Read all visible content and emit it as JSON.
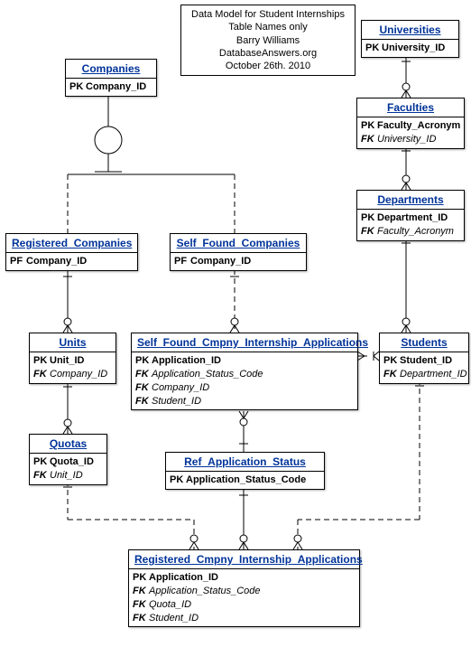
{
  "info": {
    "line1": "Data Model for Student Internships",
    "line2": "Table Names only",
    "line3": "Barry Williams",
    "line4": "DatabaseAnswers.org",
    "line5": "October 26th. 2010"
  },
  "entities": {
    "companies": {
      "title": "Companies",
      "pk": "Company_ID"
    },
    "universities": {
      "title": "Universities",
      "pk": "University_ID"
    },
    "faculties": {
      "title": "Faculties",
      "pk": "Faculty_Acronym",
      "fk1": "University_ID"
    },
    "departments": {
      "title": "Departments",
      "pk": "Department_ID",
      "fk1": "Faculty_Acronym"
    },
    "registered_companies": {
      "title": "Registered_Companies",
      "pf": "Company_ID"
    },
    "self_found_companies": {
      "title": "Self_Found_Companies",
      "pf": "Company_ID"
    },
    "students": {
      "title": "Students",
      "pk": "Student_ID",
      "fk1": "Department_ID"
    },
    "units": {
      "title": "Units",
      "pk": "Unit_ID",
      "fk1": "Company_ID"
    },
    "self_found_app": {
      "title": "Self_Found_Cmpny_Internship_Applications",
      "pk": "Application_ID",
      "fk1": "Application_Status_Code",
      "fk2": "Company_ID",
      "fk3": "Student_ID"
    },
    "quotas": {
      "title": "Quotas",
      "pk": "Quota_ID",
      "fk1": "Unit_ID"
    },
    "ref_app_status": {
      "title": "Ref_Application_Status",
      "pk": "Application_Status_Code"
    },
    "registered_app": {
      "title": "Registered_Cmpny_Internship_Applications",
      "pk": "Application_ID",
      "fk1": "Application_Status_Code",
      "fk2": "Quota_ID",
      "fk3": "Student_ID"
    }
  },
  "labels": {
    "PK": "PK",
    "PF": "PF",
    "FK": "FK"
  }
}
